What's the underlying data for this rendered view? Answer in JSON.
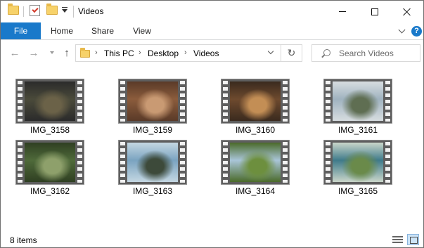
{
  "window": {
    "title": "Videos",
    "controls": {
      "minimize": "minimize",
      "maximize": "maximize",
      "close": "close"
    }
  },
  "quick_access": {
    "items": [
      "folder-icon",
      "properties-icon",
      "new-folder-icon",
      "customize-dropdown"
    ]
  },
  "ribbon": {
    "tabs": [
      "File",
      "Home",
      "Share",
      "View"
    ],
    "help": "?"
  },
  "navigation": {
    "back": "←",
    "forward": "→",
    "up": "↑",
    "refresh": "↻",
    "breadcrumbs": [
      "This PC",
      "Desktop",
      "Videos"
    ],
    "search_placeholder": "Search Videos"
  },
  "files": [
    {
      "name": "IMG_3158",
      "scene": "birds on muddy ground",
      "colors": [
        "#4a4a3a",
        "#6b6248",
        "#2b2b2b"
      ]
    },
    {
      "name": "IMG_3159",
      "scene": "brown dog lying",
      "colors": [
        "#8b5c3c",
        "#c99a73",
        "#5a3a28"
      ]
    },
    {
      "name": "IMG_3160",
      "scene": "puppy sitting",
      "colors": [
        "#6e4a2e",
        "#c38e55",
        "#3a2a1e"
      ]
    },
    {
      "name": "IMG_3161",
      "scene": "coastline and sea",
      "colors": [
        "#9fb2bf",
        "#5f6e52",
        "#d7dde0"
      ]
    },
    {
      "name": "IMG_3162",
      "scene": "jungle path",
      "colors": [
        "#4f6a3a",
        "#8ea06b",
        "#2f3f22"
      ]
    },
    {
      "name": "IMG_3163",
      "scene": "person by the sea",
      "colors": [
        "#7aa3c0",
        "#3d4a3a",
        "#c4d7e2"
      ]
    },
    {
      "name": "IMG_3164",
      "scene": "green meadow",
      "colors": [
        "#a9c5d8",
        "#6d8f3e",
        "#4a6a2a"
      ]
    },
    {
      "name": "IMG_3165",
      "scene": "pool in garden",
      "colors": [
        "#3f7a8a",
        "#6a8a4a",
        "#c9d6c9"
      ]
    }
  ],
  "status": {
    "item_count": "8 items"
  },
  "view_modes": [
    "details-view",
    "large-icons-view"
  ]
}
